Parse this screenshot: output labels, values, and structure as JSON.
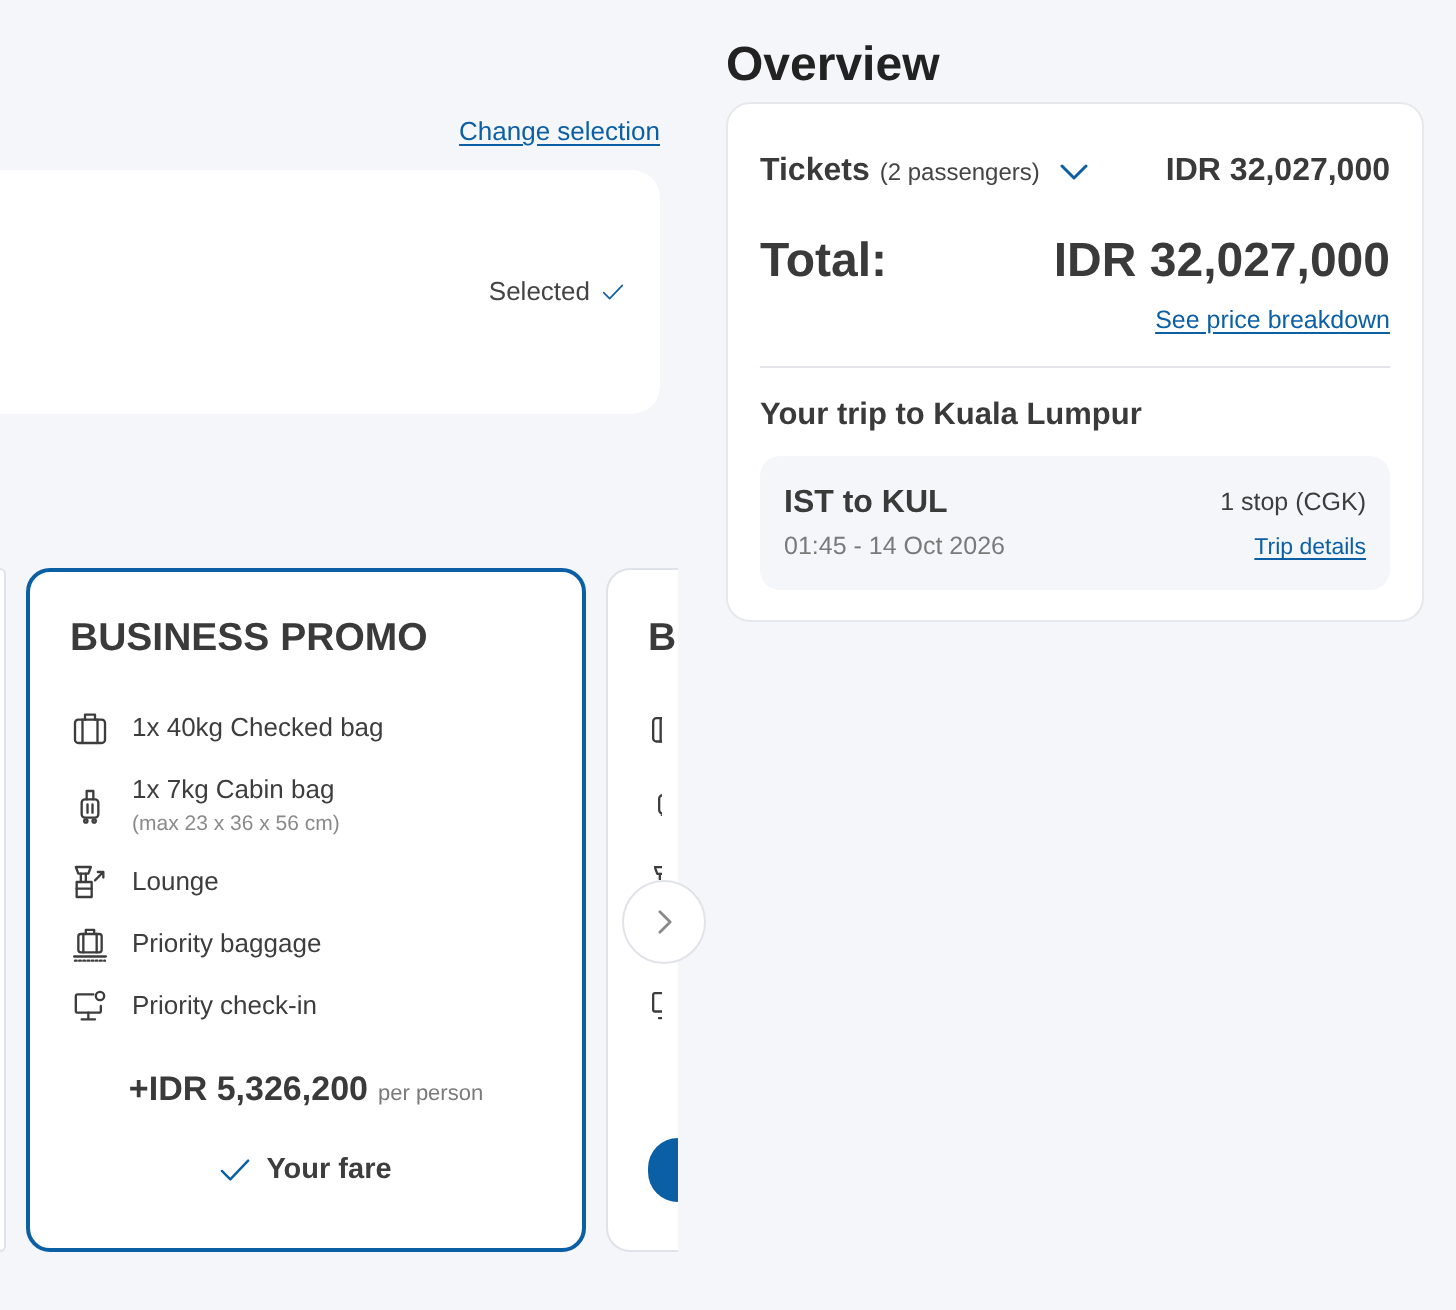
{
  "fare_summary": {
    "change_link": "Change selection",
    "status": "Selected"
  },
  "fare_carousel": {
    "cards": [
      {
        "selected": false
      },
      {
        "title": "BUSINESS PROMO",
        "selected": true,
        "features": [
          {
            "kind": "checked-bag",
            "label": "1x 40kg Checked bag"
          },
          {
            "kind": "cabin-bag",
            "label": "1x 7kg Cabin bag",
            "note": "(max 23 x 36 x 56 cm)"
          },
          {
            "kind": "lounge",
            "label": "Lounge"
          },
          {
            "kind": "priority-baggage",
            "label": "Priority baggage"
          },
          {
            "kind": "priority-checkin",
            "label": "Priority check-in"
          }
        ],
        "price": "+IDR 5,326,200",
        "price_unit": "per person",
        "status": "Your fare"
      },
      {
        "title": "B",
        "selected": false,
        "features": [
          {
            "kind": "checked-bag"
          },
          {
            "kind": "cabin-bag"
          },
          {
            "kind": "lounge"
          },
          {
            "kind": "priority-checkin"
          }
        ]
      }
    ]
  },
  "overview": {
    "title": "Overview",
    "tickets": {
      "label": "Tickets",
      "passengers": "(2 passengers)",
      "expanded": false,
      "price": "IDR 32,027,000"
    },
    "total": {
      "label": "Total:",
      "price": "IDR 32,027,000"
    },
    "breakdown_link": "See price breakdown",
    "trip": {
      "title": "Your trip to Kuala Lumpur",
      "segments": [
        {
          "route": "IST to KUL",
          "time": "01:45 - 14 Oct 2026",
          "stops": "1 stop (CGK)",
          "link": "Trip details"
        }
      ]
    }
  }
}
